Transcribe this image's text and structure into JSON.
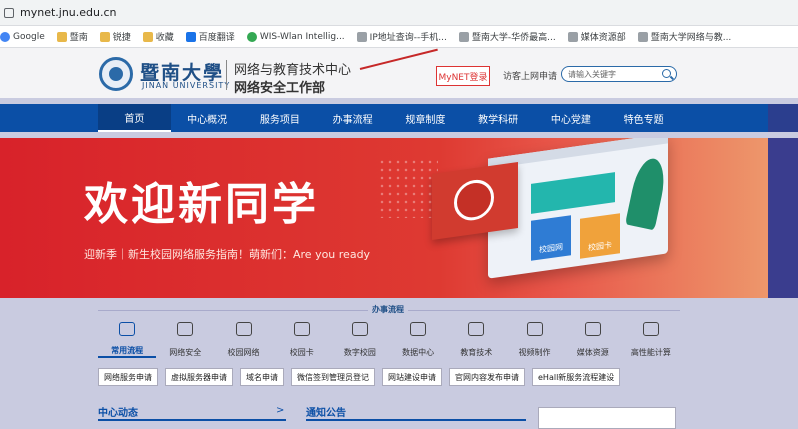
{
  "browser": {
    "url": "mynet.jnu.edu.cn",
    "bookmarks": [
      "Google",
      "暨南",
      "锐捷",
      "收藏",
      "百度翻译",
      "WIS-Wlan Intellig...",
      "IP地址查询--手机...",
      "暨南大学-华侨最高...",
      "媒体资源部",
      "暨南大学网络与教..."
    ]
  },
  "header": {
    "logo_cn": "暨南大學",
    "logo_en": "JINAN UNIVERSITY",
    "dept_line1": "网络与教育技术中心",
    "dept_line2": "网络安全工作部",
    "login_button": "MyNET登录",
    "apply_link": "访客上网申请",
    "search_placeholder": "请输入关键字"
  },
  "nav": {
    "items": [
      "首页",
      "中心概况",
      "服务项目",
      "办事流程",
      "规章制度",
      "教学科研",
      "中心党建",
      "特色专题"
    ]
  },
  "banner": {
    "title": "欢迎新同学",
    "subtitle": "迎新季｜新生校园网络服务指南！萌新们：Are you ready",
    "card_campus_net": "校园网",
    "card_campus_card": "校园卡"
  },
  "services": {
    "title": "办事流程",
    "tabs": [
      "常用流程",
      "网络安全",
      "校园网络",
      "校园卡",
      "数字校园",
      "数据中心",
      "教育技术",
      "视频制作",
      "媒体资源",
      "高性能计算"
    ],
    "buttons": [
      "网络服务申请",
      "虚拟服务器申请",
      "域名申请",
      "微信签到管理员登记",
      "网站建设申请",
      "官网内容发布申请",
      "eHall新服务流程建设"
    ]
  },
  "bottom": {
    "news_title": "中心动态",
    "news_more": ">",
    "notice_title": "通知公告"
  }
}
